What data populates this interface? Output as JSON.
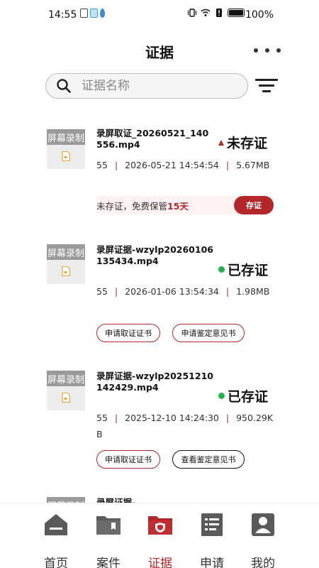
{
  "status_bar": {
    "time": "14:55",
    "battery_pct": "100%"
  },
  "header": {
    "title": "证据"
  },
  "search": {
    "placeholder": "证据名称"
  },
  "thumb_label": "屏幕录制",
  "cards": [
    {
      "file_name": "录屏取证_20260521_140556.mp4",
      "status": "未存证",
      "count": "55",
      "datetime": "2026-05-21 14:54:54",
      "size": "5.67MB",
      "notice_text": "未存证，免费保管",
      "notice_days": "15天",
      "action_label": "存证"
    },
    {
      "file_name": "录屏证据-wzylp20260106135434.mp4",
      "status": "已存证",
      "count": "55",
      "datetime": "2026-01-06 13:54:34",
      "size": "1.98MB",
      "btn1": "申请取证证书",
      "btn2": "申请鉴定意见书"
    },
    {
      "file_name": "录屏证据-wzylp20251210142429.mp4",
      "status": "已存证",
      "count": "55",
      "datetime": "2025-12-10 14:24:30",
      "size": "950.29KB",
      "btn1": "申请取证证书",
      "btn2": "查看鉴定意见书"
    },
    {
      "file_name": "录屏证据-"
    }
  ],
  "tabs": [
    {
      "label": "首页",
      "icon": "home-icon"
    },
    {
      "label": "案件",
      "icon": "folder-icon"
    },
    {
      "label": "证据",
      "icon": "evidence-folder-icon",
      "active": true
    },
    {
      "label": "申请",
      "icon": "form-icon"
    },
    {
      "label": "我的",
      "icon": "user-icon"
    }
  ],
  "colors": {
    "accent": "#b3262a",
    "certified": "#22b24c"
  }
}
